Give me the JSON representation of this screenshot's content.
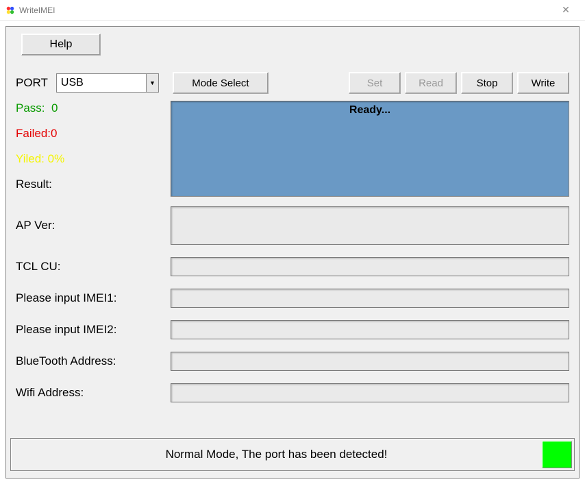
{
  "window": {
    "title": "WriteIMEI"
  },
  "toolbar": {
    "help_label": "Help",
    "port_label": "PORT",
    "port_value": "USB",
    "mode_select_label": "Mode Select",
    "set_label": "Set",
    "read_label": "Read",
    "stop_label": "Stop",
    "write_label": "Write"
  },
  "stats": {
    "pass_label": "Pass:",
    "pass_value": "0",
    "fail_label": "Failed:",
    "fail_value": "0",
    "yield_label": "Yiled:",
    "yield_value": "0%",
    "result_label": "Result:"
  },
  "ready_text": "Ready...",
  "fields": {
    "ap_ver_label": "AP Ver:",
    "ap_ver_value": "",
    "tcl_cu_label": "TCL CU:",
    "tcl_cu_value": "",
    "imei1_label": "Please input IMEI1:",
    "imei1_value": "",
    "imei2_label": "Please input IMEI2:",
    "imei2_value": "",
    "bt_label": "BlueTooth Address:",
    "bt_value": "",
    "wifi_label": "Wifi Address:",
    "wifi_value": ""
  },
  "status": {
    "text": "Normal Mode, The port has been detected!"
  }
}
